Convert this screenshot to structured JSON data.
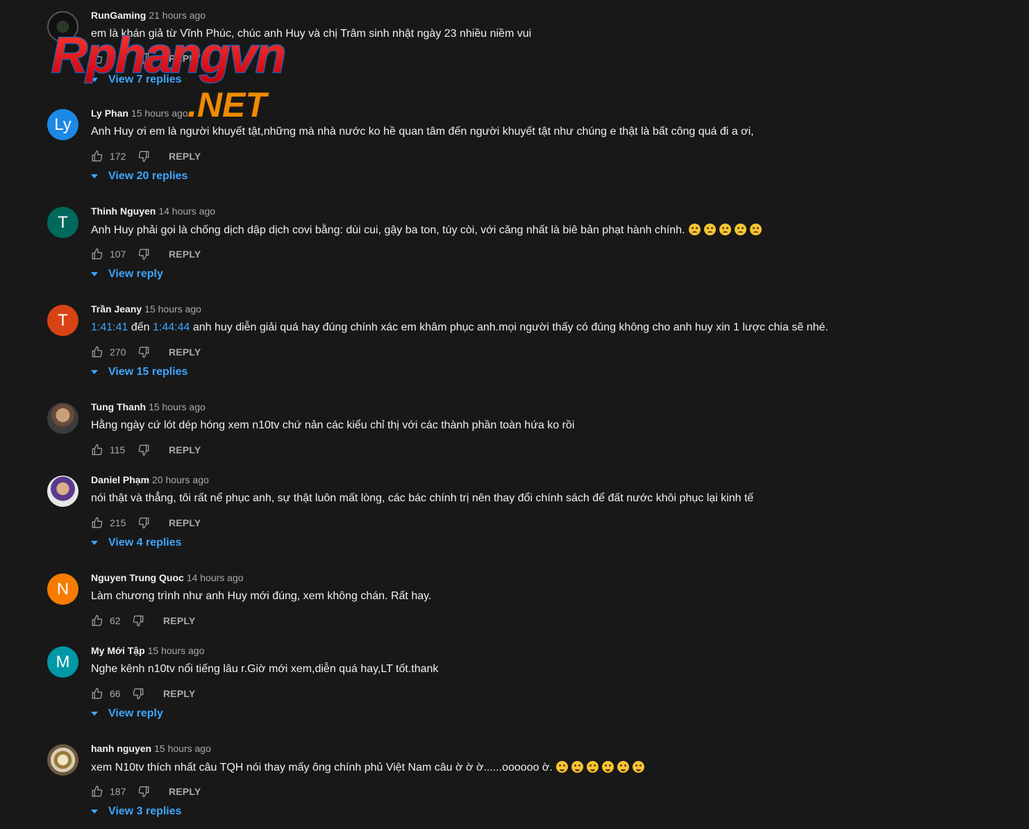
{
  "watermark": {
    "brand": "Rphangvn",
    "suffix": ".NET",
    "brand_color": "#e8101a",
    "suffix_color": "#f08a00"
  },
  "comments": [
    {
      "author": "RunGaming",
      "time": "21 hours ago",
      "avatar_letter": "",
      "avatar_color": "",
      "text_parts": [
        "em là khán giả từ Vĩnh Phúc, chúc anh Huy và chị Trâm sinh nhật ngày 23 nhiều niềm vui"
      ],
      "likes": "3",
      "reply": "REPLY",
      "view_replies": "View 7 replies"
    },
    {
      "author": "Ly Phan",
      "time": "15 hours ago",
      "avatar_letter": "Ly",
      "avatar_color": "#1e88e5",
      "text_parts": [
        "Anh Huy ơi em là người khuyết tật,những mà nhà nước ko hề quan tâm đến người khuyết tật như chúng e thật là bất công quá đi a ơi,"
      ],
      "likes": "172",
      "reply": "REPLY",
      "view_replies": "View 20 replies"
    },
    {
      "author": "Thinh Nguyen",
      "time": "14 hours ago",
      "avatar_letter": "T",
      "avatar_color": "#00695c",
      "text_parts": [
        "Anh Huy phải gọi là chống dịch dập dịch covi bằng: dùi cui, gậy ba ton, túy còi, với căng nhất là biê  bản phạt hành chính."
      ],
      "likes": "107",
      "reply": "REPLY",
      "view_replies": "View reply"
    },
    {
      "author": "Trần Jeany",
      "time": "15 hours ago",
      "avatar_letter": "T",
      "avatar_color": "#d84315",
      "text_parts": [
        "1:41:41",
        " đến ",
        "1:44:44",
        " anh huy diễn giải quá hay đúng chính xác em khâm phục anh.mọi người thấy có đúng không cho anh huy xin 1 lược chia sẽ nhé."
      ],
      "likes": "270",
      "reply": "REPLY",
      "view_replies": "View 15 replies"
    },
    {
      "author": "Tung Thanh",
      "time": "15 hours ago",
      "avatar_letter": "",
      "avatar_color": "",
      "text_parts": [
        "Hằng ngày cứ lót dép hóng xem n10tv chứ nản các kiểu chỉ thị với các thành phần toàn hứa ko rồi"
      ],
      "likes": "115",
      "reply": "REPLY",
      "view_replies": ""
    },
    {
      "author": "Daniel Phạm",
      "time": "20 hours ago",
      "avatar_letter": "",
      "avatar_color": "",
      "text_parts": [
        "nói thật và thẳng, tôi rất nể phục anh, sự thật luôn mất lòng, các bác chính trị nên thay đổi chính sách để đất nước khôi phục lại kinh tế"
      ],
      "likes": "215",
      "reply": "REPLY",
      "view_replies": "View 4 replies"
    },
    {
      "author": "Nguyen Trung Quoc",
      "time": "14 hours ago",
      "avatar_letter": "N",
      "avatar_color": "#f57c00",
      "text_parts": [
        "Làm chương trình như anh Huy mới đúng, xem không chán. Rất hay."
      ],
      "likes": "62",
      "reply": "REPLY",
      "view_replies": ""
    },
    {
      "author": "My Mới Tập",
      "time": "15 hours ago",
      "avatar_letter": "M",
      "avatar_color": "#0097a7",
      "text_parts": [
        "Nghe kênh n10tv nổi tiếng lâu r.Giờ mới xem,diễn quá hay,LT tốt.thank"
      ],
      "likes": "66",
      "reply": "REPLY",
      "view_replies": "View reply"
    },
    {
      "author": "hanh nguyen",
      "time": "15 hours ago",
      "avatar_letter": "",
      "avatar_color": "",
      "text_parts": [
        "xem N10tv thích nhất câu TQH nói thay mấy ông chính phủ Việt Nam câu ờ ờ ờ......oooooo ờ."
      ],
      "likes": "187",
      "reply": "REPLY",
      "view_replies": "View 3 replies"
    }
  ]
}
